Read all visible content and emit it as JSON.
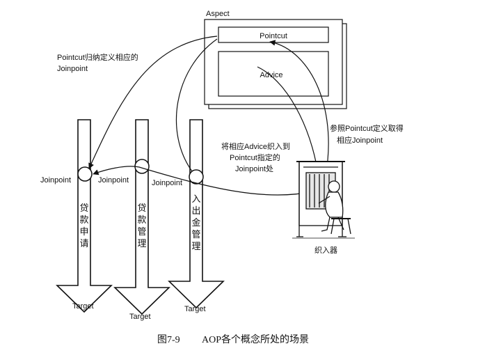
{
  "aspect": {
    "title": "Aspect",
    "pointcut": "Pointcut",
    "advice": "Advice"
  },
  "notes": {
    "pointcut_line1": "Pointcut归纳定义相应的",
    "pointcut_line2": "Joinpoint",
    "weave_line1": "将相应Advice织入到",
    "weave_line2": "Pointcut指定的",
    "weave_line3": "Joinpoint处",
    "ref_line1": "参照Pointcut定义取得",
    "ref_line2": "相应Joinpoint"
  },
  "flows": [
    {
      "label_chars": [
        "贷",
        "款",
        "申",
        "请"
      ],
      "joinpoint": "Joinpoint",
      "target": "Target"
    },
    {
      "label_chars": [
        "贷",
        "款",
        "管",
        "理"
      ],
      "joinpoint": "Joinpoint",
      "target": "Target"
    },
    {
      "label_chars": [
        "入",
        "出",
        "金",
        "管",
        "理"
      ],
      "joinpoint": "Joinpoint",
      "target": "Target"
    }
  ],
  "weaver": {
    "label": "织入器"
  },
  "caption": {
    "number": "图7-9",
    "text": "AOP各个概念所处的场景"
  }
}
